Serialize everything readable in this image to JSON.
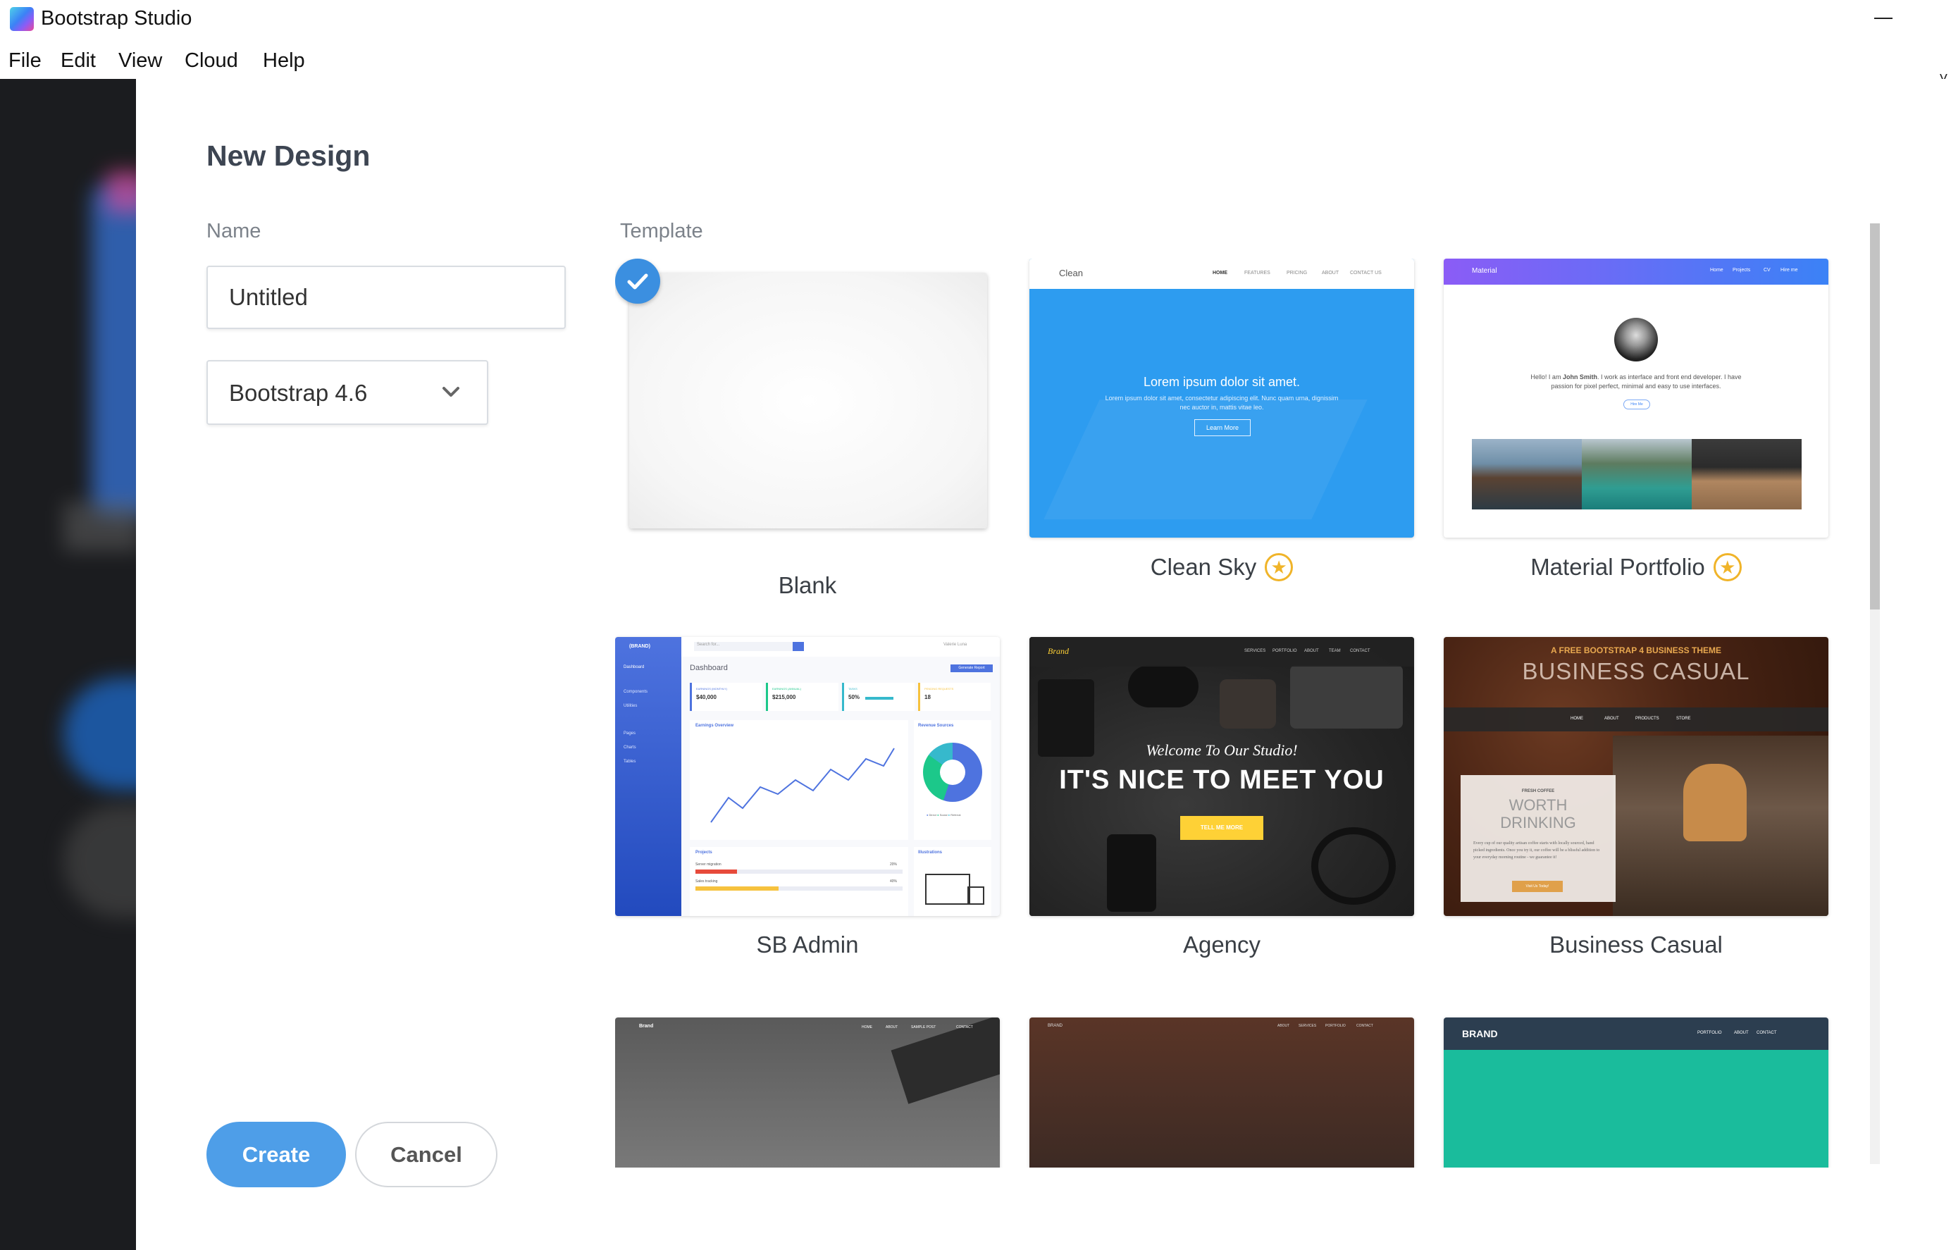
{
  "window": {
    "title": "Bootstrap Studio",
    "icon": "bootstrap-studio-logo-icon"
  },
  "menu": [
    "File",
    "Edit",
    "View",
    "Cloud",
    "Help"
  ],
  "dialog": {
    "title": "New Design",
    "name_label": "Name",
    "name_value": "Untitled",
    "version_value": "Bootstrap 4.6",
    "template_label": "Template",
    "selected_template": "Blank",
    "create_label": "Create",
    "cancel_label": "Cancel"
  },
  "templates": [
    {
      "name": "Blank",
      "starred": false,
      "selected": true
    },
    {
      "name": "Clean Sky",
      "starred": true,
      "selected": false
    },
    {
      "name": "Material Portfolio",
      "starred": true,
      "selected": false
    },
    {
      "name": "SB Admin",
      "starred": false,
      "selected": false
    },
    {
      "name": "Agency",
      "starred": false,
      "selected": false
    },
    {
      "name": "Business Casual",
      "starred": false,
      "selected": false
    }
  ],
  "previews": {
    "clean": {
      "brand": "Clean",
      "nav": [
        "HOME",
        "FEATURES",
        "PRICING",
        "ABOUT",
        "CONTACT US"
      ],
      "headline": "Lorem ipsum dolor sit amet.",
      "body": "Lorem ipsum dolor sit amet, consectetur adipiscing elit. Nunc quam urna, dignissim nec auctor in, mattis vitae leo.",
      "button": "Learn More"
    },
    "material": {
      "brand": "Material",
      "nav": [
        "Home",
        "Projects",
        "CV",
        "Hire me"
      ],
      "intro_prefix": "Hello! I am ",
      "intro_name": "John Smith",
      "intro_rest": ". I work as interface and front end developer. I have passion for pixel perfect, minimal and easy to use interfaces.",
      "button": "Hire Me"
    },
    "sbadmin": {
      "brand": "(BRAND)",
      "search": "Search for...",
      "side_items": [
        "Dashboard",
        "Components",
        "Utilities",
        "Pages",
        "Charts",
        "Tables"
      ],
      "heading": "Dashboard",
      "report_btn": "Generate Report",
      "user": "Valerie Luna",
      "stats": [
        {
          "label": "EARNINGS (MONTHLY)",
          "value": "$40,000",
          "color": "#4e73df"
        },
        {
          "label": "EARNINGS (ANNUAL)",
          "value": "$215,000",
          "color": "#1cc88a"
        },
        {
          "label": "TASKS",
          "value": "50%",
          "color": "#36b9cc"
        },
        {
          "label": "PENDING REQUESTS",
          "value": "18",
          "color": "#f6c23e"
        }
      ],
      "earnings_title": "Earnings Overview",
      "revenue_title": "Revenue Sources",
      "legend": [
        "Direct",
        "Social",
        "Referral"
      ],
      "projects_title": "Projects",
      "illustrations_title": "Illustrations",
      "projects": [
        {
          "name": "Server migration",
          "value": "20%"
        },
        {
          "name": "Sales tracking",
          "value": "40%"
        }
      ]
    },
    "agency": {
      "brand": "Brand",
      "nav": [
        "SERVICES",
        "PORTFOLIO",
        "ABOUT",
        "TEAM",
        "CONTACT"
      ],
      "welcome": "Welcome To Our Studio!",
      "headline": "IT'S NICE TO MEET YOU",
      "button": "TELL ME MORE"
    },
    "business": {
      "tagline": "A FREE BOOTSTRAP 4 BUSINESS THEME",
      "title": "BUSINESS CASUAL",
      "nav": [
        "HOME",
        "ABOUT",
        "PRODUCTS",
        "STORE"
      ],
      "card_kicker": "FRESH COFFEE",
      "card_title_1": "WORTH",
      "card_title_2": "DRINKING",
      "card_body": "Every cup of our quality artisan coffee starts with locally sourced, hand picked ingredients. Once you try it, our coffee will be a blissful addition to your everyday morning routine - we guarantee it!",
      "button": "Visit Us Today!"
    },
    "row3": [
      {
        "brand": "Brand",
        "nav": [
          "HOME",
          "ABOUT",
          "SAMPLE POST",
          "CONTACT"
        ]
      },
      {
        "brand": "BRAND",
        "nav": [
          "ABOUT",
          "SERVICES",
          "PORTFOLIO",
          "CONTACT"
        ]
      },
      {
        "brand": "BRAND",
        "nav": [
          "PORTFOLIO",
          "ABOUT",
          "CONTACT"
        ]
      }
    ]
  },
  "colors": {
    "accent": "#4e9ee8",
    "check": "#3b8fe0",
    "star": "#f0b429",
    "clean_blue": "#2d9cf0",
    "material_gradient_start": "#8b5cf6",
    "material_gradient_end": "#3b82f6",
    "sb_blue": "#4e73df",
    "agency_yellow": "#fed136"
  }
}
